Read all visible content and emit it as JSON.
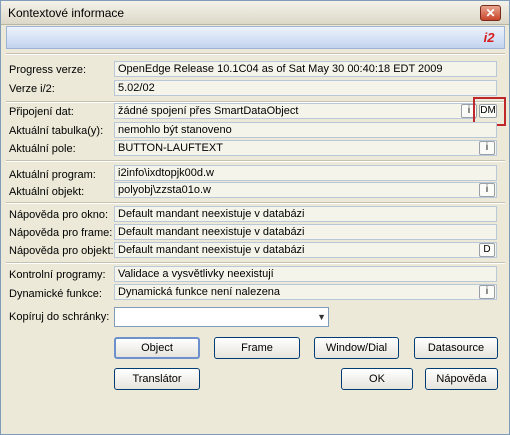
{
  "window": {
    "title": "Kontextové informace",
    "close_glyph": "✕",
    "logo_text": "i2"
  },
  "fields": {
    "progress_label": "Progress verze:",
    "progress_value": "OpenEdge Release 10.1C04 as of Sat May 30 00:40:18 EDT 2009",
    "verze_label": "Verze i/2:",
    "verze_value": "5.02/02",
    "pripojeni_label": "Připojení dat:",
    "pripojeni_value": "žádné spojení přes SmartDataObject",
    "tabulka_label": "Aktuální tabulka(y):",
    "tabulka_value": "nemohlo být stanoveno",
    "pole_label": "Aktuální pole:",
    "pole_value": "BUTTON-LAUFTEXT",
    "program_label": "Aktuální program:",
    "program_value": "i2info\\ixdtopjk00d.w",
    "objekt_label": "Aktuální objekt:",
    "objekt_value": "polyobj\\zzsta01o.w",
    "napoveda_okno_label": "Nápověda pro okno:",
    "napoveda_okno_value": "Default mandant neexistuje v databázi",
    "napoveda_frame_label": "Nápověda pro frame:",
    "napoveda_frame_value": "Default mandant neexistuje v databázi",
    "napoveda_objekt_label": "Nápověda pro objekt:",
    "napoveda_objekt_value": "Default mandant neexistuje v databázi",
    "kontrolni_label": "Kontrolní programy:",
    "kontrolni_value": "Validace a vysvětlivky neexistují",
    "dynamicke_label": "Dynamické funkce:",
    "dynamicke_value": "Dynamická funkce není nalezena",
    "kopiruj_label": "Kopíruj do schránky:",
    "kopiruj_value": ""
  },
  "small_buttons": {
    "info": "i",
    "dm": "DM",
    "d": "D"
  },
  "buttons": {
    "object": "Object",
    "frame": "Frame",
    "window_dial": "Window/Dial",
    "datasource": "Datasource",
    "translator": "Translátor",
    "ok": "OK",
    "napoveda": "Nápověda"
  }
}
